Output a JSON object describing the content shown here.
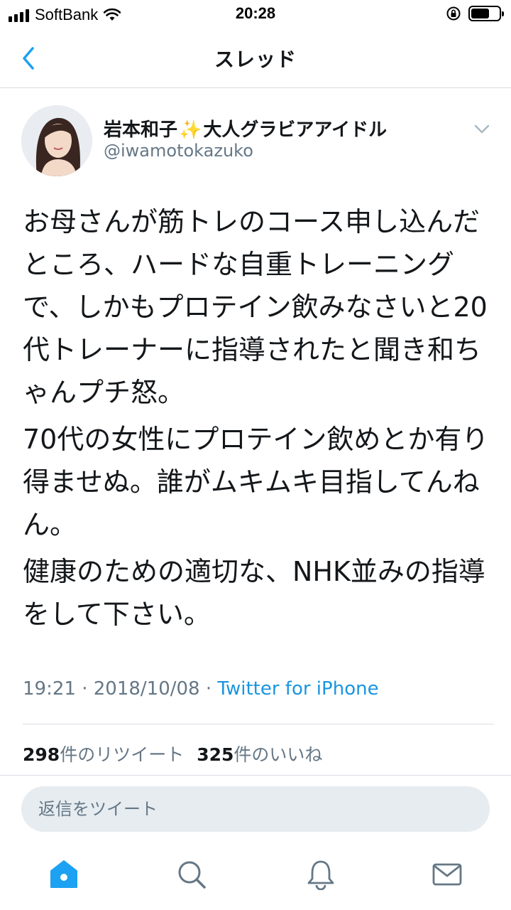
{
  "status_bar": {
    "carrier": "SoftBank",
    "time": "20:28"
  },
  "nav": {
    "title": "スレッド"
  },
  "tweet": {
    "user_name": "岩本和子",
    "sparkle": "✨",
    "user_name_suffix": "大人グラビアアイドル",
    "handle": "@iwamotokazuko",
    "paragraphs": [
      "お母さんが筋トレのコース申し込んだところ、ハードな自重トレーニングで、しかもプロテイン飲みなさいと20代トレーナーに指導されたと聞き和ちゃんプチ怒。",
      "70代の女性にプロテイン飲めとか有り得ませぬ。誰がムキムキ目指してんねん。",
      "健康のための適切な、NHK並みの指導をして下さい。"
    ],
    "time": "19:21",
    "date": "2018/10/08",
    "separator": "·",
    "source": "Twitter for iPhone",
    "retweet_count": "298",
    "retweet_label": "件のリツイート",
    "like_count": "325",
    "like_label": "件のいいね"
  },
  "reply": {
    "placeholder": "返信をツイート"
  },
  "colors": {
    "accent": "#1b95e0",
    "muted": "#657786",
    "reply_bg": "#e6ecf0",
    "home_active": "#1da1f2",
    "tab_inactive": "#657786"
  },
  "icons": [
    "back-chevron-icon",
    "caret-down-icon",
    "home-icon",
    "search-icon",
    "bell-icon",
    "mail-icon"
  ]
}
